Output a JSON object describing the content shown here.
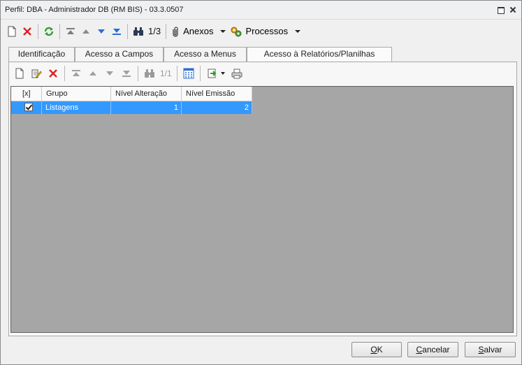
{
  "window": {
    "title": "Perfil: DBA - Administrador DB (RM BIS) - 03.3.0507"
  },
  "toolbar": {
    "record_counter": "1/3",
    "anexos_label": "Anexos",
    "processos_label": "Processos"
  },
  "tabs": [
    {
      "label": "Identificação"
    },
    {
      "label": "Acesso a Campos"
    },
    {
      "label": "Acesso a Menus"
    },
    {
      "label": "Acesso à Relatórios/Planilhas"
    }
  ],
  "subtoolbar": {
    "record_counter": "1/1"
  },
  "grid": {
    "columns": [
      "[x]",
      "Grupo",
      "Nível Alteração",
      "Nível Emissão"
    ],
    "rows": [
      {
        "checked": true,
        "grupo": "Listagens",
        "nivel_alteracao": "1",
        "nivel_emissao": "2"
      }
    ]
  },
  "buttons": {
    "ok_u": "O",
    "ok_rest": "K",
    "cancel_u": "C",
    "cancel_rest": "ancelar",
    "save_u": "S",
    "save_rest": "alvar"
  },
  "colors": {
    "selection": "#3399ff",
    "grid_background": "#a6a6a6",
    "delete_red": "#e02020",
    "refresh_green": "#2e9e2e",
    "nav_blue": "#2a6fd1"
  }
}
